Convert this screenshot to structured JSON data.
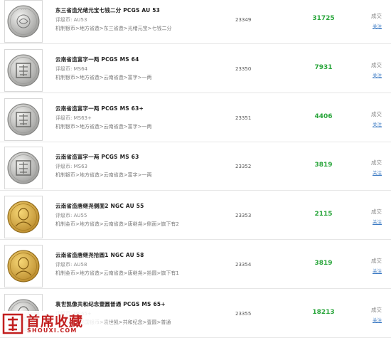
{
  "items": [
    {
      "title": "东三省造光绪元宝七钱二分 PCGS AU 53",
      "grade": "评级币: AU53",
      "category": "机制银币>地方省造>东三省造>光绪元宝>七钱二分",
      "lot": "23349",
      "price": "31725",
      "status": "成交",
      "follow": "关注",
      "coin": "silver-dragon"
    },
    {
      "title": "云南省造富字一两 PCGS MS 64",
      "grade": "评级币: MS64",
      "category": "机制银币>地方省造>云南省造>富字>一两",
      "lot": "23350",
      "price": "7931",
      "status": "成交",
      "follow": "关注",
      "coin": "silver-fu"
    },
    {
      "title": "云南省造富字一两 PCGS MS 63+",
      "grade": "评级币: MS63+",
      "category": "机制银币>地方省造>云南省造>富字>一两",
      "lot": "23351",
      "price": "4406",
      "status": "成交",
      "follow": "关注",
      "coin": "silver-fu"
    },
    {
      "title": "云南省造富字一两 PCGS MS 63",
      "grade": "评级币: MS63",
      "category": "机制银币>地方省造>云南省造>富字>一两",
      "lot": "23352",
      "price": "3819",
      "status": "成交",
      "follow": "关注",
      "coin": "silver-fu"
    },
    {
      "title": "云南省造唐继尧侧面2 NGC AU 55",
      "grade": "评级币: AU55",
      "category": "机制金币>地方省造>云南省造>唐继尧>侧面>旗下有2",
      "lot": "23353",
      "price": "2115",
      "status": "成交",
      "follow": "关注",
      "coin": "gold-portrait"
    },
    {
      "title": "云南省造唐继尧拾圆1 NGC AU 58",
      "grade": "评级币: AU58",
      "category": "机制金币>地方省造>云南省造>唐继尧>拾圆>旗下有1",
      "lot": "23354",
      "price": "3819",
      "status": "成交",
      "follow": "关注",
      "coin": "gold-portrait"
    },
    {
      "title": "袁世凯像共和纪念壹圆普通 PCGS MS 65+",
      "grade": "评级币: MS65+",
      "category": "机制银币>民国银币>袁世凯>共和纪念>壹圆>普通",
      "lot": "23355",
      "price": "18213",
      "status": "成交",
      "follow": "关注",
      "coin": "silver-portrait"
    }
  ],
  "watermark": {
    "title": "首席收藏",
    "url": "SHOUXI.COM"
  },
  "colors": {
    "price": "#2aa63c",
    "link": "#3a79c3",
    "watermark": "#c21f1f"
  }
}
